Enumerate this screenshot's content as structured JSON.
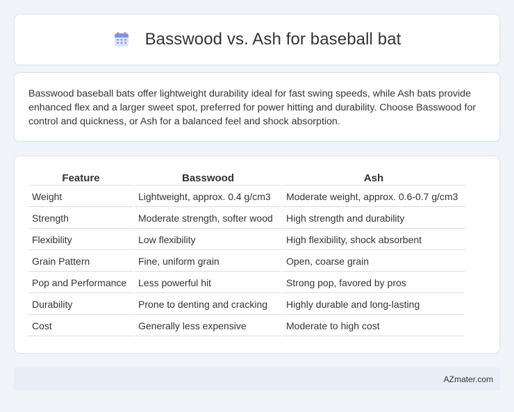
{
  "header": {
    "title": "Basswood vs. Ash for baseball bat",
    "icon": "calendar-icon"
  },
  "summary": {
    "text": "Basswood baseball bats offer lightweight durability ideal for fast swing speeds, while Ash bats provide enhanced flex and a larger sweet spot, preferred for power hitting and durability. Choose Basswood for control and quickness, or Ash for a balanced feel and shock absorption."
  },
  "table": {
    "headers": [
      "Feature",
      "Basswood",
      "Ash"
    ],
    "rows": [
      [
        "Weight",
        "Lightweight, approx. 0.4 g/cm3",
        "Moderate weight, approx. 0.6-0.7 g/cm3"
      ],
      [
        "Strength",
        "Moderate strength, softer wood",
        "High strength and durability"
      ],
      [
        "Flexibility",
        "Low flexibility",
        "High flexibility, shock absorbent"
      ],
      [
        "Grain Pattern",
        "Fine, uniform grain",
        "Open, coarse grain"
      ],
      [
        "Pop and Performance",
        "Less powerful hit",
        "Strong pop, favored by pros"
      ],
      [
        "Durability",
        "Prone to denting and cracking",
        "Highly durable and long-lasting"
      ],
      [
        "Cost",
        "Generally less expensive",
        "Moderate to high cost"
      ]
    ]
  },
  "footer": {
    "source": "AZmater.com"
  },
  "colors": {
    "background": "#f0f3f8",
    "card": "#ffffff",
    "footer_bg": "#e8edf6",
    "icon_accent": "#5b7bd5",
    "icon_top": "#e06b8b"
  }
}
